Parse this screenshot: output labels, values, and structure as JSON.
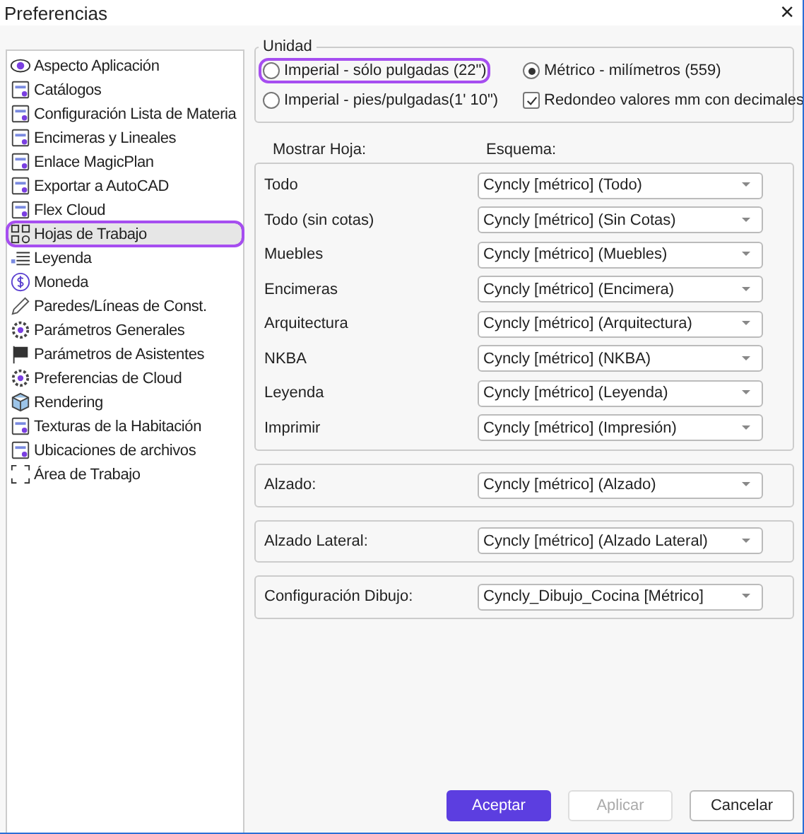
{
  "window": {
    "title": "Preferencias",
    "close": "×"
  },
  "sidebar": {
    "items": [
      {
        "label": "Aspecto Aplicación",
        "selected": false,
        "highlighted": false
      },
      {
        "label": "Catálogos",
        "selected": false,
        "highlighted": false
      },
      {
        "label": "Configuración Lista de Materia",
        "selected": false,
        "highlighted": false
      },
      {
        "label": "Encimeras y Lineales",
        "selected": false,
        "highlighted": false
      },
      {
        "label": "Enlace MagicPlan",
        "selected": false,
        "highlighted": false
      },
      {
        "label": "Exportar a AutoCAD",
        "selected": false,
        "highlighted": false
      },
      {
        "label": "Flex Cloud",
        "selected": false,
        "highlighted": false
      },
      {
        "label": "Hojas de Trabajo",
        "selected": true,
        "highlighted": true
      },
      {
        "label": "Leyenda",
        "selected": false,
        "highlighted": false
      },
      {
        "label": "Moneda",
        "selected": false,
        "highlighted": false
      },
      {
        "label": "Paredes/Líneas de Const.",
        "selected": false,
        "highlighted": false
      },
      {
        "label": "Parámetros Generales",
        "selected": false,
        "highlighted": false
      },
      {
        "label": "Parámetros de Asistentes",
        "selected": false,
        "highlighted": false
      },
      {
        "label": "Preferencias de Cloud",
        "selected": false,
        "highlighted": false
      },
      {
        "label": "Rendering",
        "selected": false,
        "highlighted": false
      },
      {
        "label": "Texturas de la Habitación",
        "selected": false,
        "highlighted": false
      },
      {
        "label": "Ubicaciones de archivos",
        "selected": false,
        "highlighted": false
      },
      {
        "label": "Área de Trabajo",
        "selected": false,
        "highlighted": false
      }
    ]
  },
  "unit": {
    "legend": "Unidad",
    "options": [
      {
        "kind": "radio",
        "label": "Imperial - sólo pulgadas (22\")",
        "selected": false,
        "highlighted": true
      },
      {
        "kind": "radio",
        "label": "Métrico - milímetros (559)",
        "selected": true,
        "highlighted": false
      },
      {
        "kind": "radio",
        "label": "Imperial - pies/pulgadas(1' 10\")",
        "selected": false,
        "highlighted": false
      },
      {
        "kind": "checkbox",
        "label": "Redondeo valores mm con decimales",
        "checked": true,
        "highlighted": false
      }
    ]
  },
  "sheets": {
    "header_sheet": "Mostrar Hoja:",
    "header_scheme": "Esquema:",
    "rows": [
      {
        "label": "Todo",
        "scheme": "Cyncly [métrico] (Todo)"
      },
      {
        "label": "Todo (sin cotas)",
        "scheme": "Cyncly [métrico] (Sin Cotas)"
      },
      {
        "label": "Muebles",
        "scheme": "Cyncly [métrico] (Muebles)"
      },
      {
        "label": "Encimeras",
        "scheme": "Cyncly [métrico] (Encimera)"
      },
      {
        "label": "Arquitectura",
        "scheme": "Cyncly [métrico] (Arquitectura)"
      },
      {
        "label": "NKBA",
        "scheme": "Cyncly [métrico] (NKBA)"
      },
      {
        "label": "Leyenda",
        "scheme": "Cyncly [métrico] (Leyenda)"
      },
      {
        "label": "Imprimir",
        "scheme": "Cyncly [métrico] (Impresión)"
      }
    ]
  },
  "extras": [
    {
      "label": "Alzado:",
      "scheme": "Cyncly [métrico] (Alzado)"
    },
    {
      "label": "Alzado Lateral:",
      "scheme": "Cyncly [métrico] (Alzado Lateral)"
    },
    {
      "label": "Configuración Dibujo:",
      "scheme": "Cyncly_Dibujo_Cocina [Métrico]"
    }
  ],
  "buttons": [
    {
      "label": "Aceptar",
      "kind": "primary",
      "disabled": false
    },
    {
      "label": "Aplicar",
      "kind": "normal",
      "disabled": true
    },
    {
      "label": "Cancelar",
      "kind": "normal",
      "disabled": false
    }
  ]
}
